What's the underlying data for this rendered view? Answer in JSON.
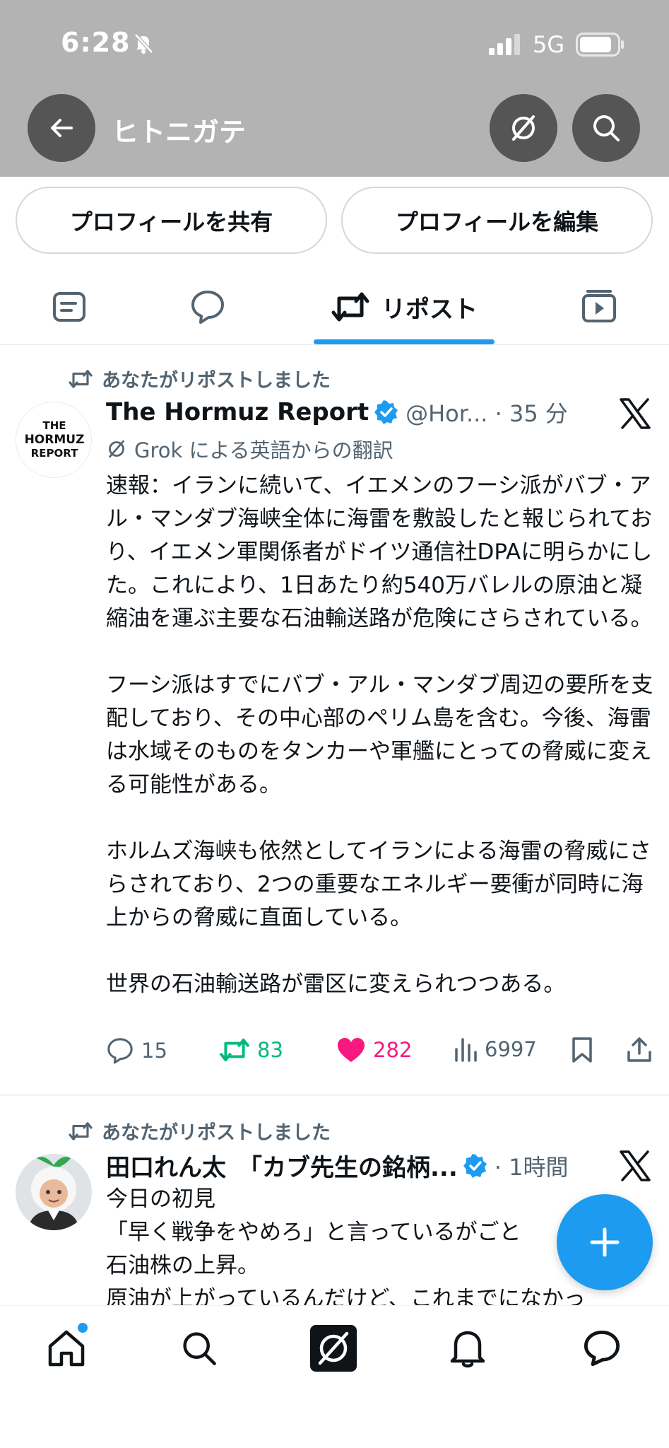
{
  "status_bar": {
    "time": "6:28",
    "network": "5G"
  },
  "header": {
    "title": "ヒトニガテ"
  },
  "profile_actions": {
    "share_label": "プロフィールを共有",
    "edit_label": "プロフィールを編集"
  },
  "tabs": {
    "reposts_label": "リポスト",
    "active": "reposts"
  },
  "tweets": [
    {
      "repost_label": "あなたがリポストしました",
      "avatar_text": "THE HORMUZ REPORT",
      "display_name": "The Hormuz Report",
      "handle_time": "@Hor... · 35 分",
      "translation_note": "Grok による英語からの翻訳",
      "text": "速報：イランに続いて、イエメンのフーシ派がバブ・アル・マンダブ海峡全体に海雷を敷設したと報じられており、イエメン軍関係者がドイツ通信社DPAに明らかにした。これにより、1日あたり約540万バレルの原油と凝縮油を運ぶ主要な石油輸送路が危険にさらされている。\n\nフーシ派はすでにバブ・アル・マンダブ周辺の要所を支配しており、その中心部のペリム島を含む。今後、海雷は水域そのものをタンカーや軍艦にとっての脅威に変える可能性がある。\n\nホルムズ海峡も依然としてイランによる海雷の脅威にさらされており、2つの重要なエネルギー要衝が同時に海上からの脅威に直面している。\n\n世界の石油輸送路が雷区に変えられつつある。",
      "replies": "15",
      "reposts": "83",
      "likes": "282",
      "views": "6997"
    },
    {
      "repost_label": "あなたがリポストしました",
      "display_name": "田口れん太　「カブ先生の銘柄...",
      "handle_time": "· 1時間",
      "text": "今日の初見\n「早く戦争をやめろ」と言っているがごと\n石油株の上昇。\n原油が上がっているんだけど、これまでになかっ"
    }
  ],
  "colors": {
    "accent": "#1d9bf0",
    "repost_green": "#00ba7c",
    "like_pink": "#f91880",
    "secondary_text": "#536471",
    "header_grey": "#b3b3b3"
  },
  "icons": [
    "mute-icon",
    "signal-icon",
    "battery-icon",
    "back-arrow-icon",
    "grok-icon",
    "search-icon",
    "posts-tab-icon",
    "replies-tab-icon",
    "repost-icon",
    "media-tab-icon",
    "verified-icon",
    "x-logo-icon",
    "reply-icon",
    "heart-icon",
    "views-icon",
    "bookmark-icon",
    "share-icon",
    "plus-icon",
    "home-icon",
    "bell-icon",
    "messages-icon"
  ]
}
